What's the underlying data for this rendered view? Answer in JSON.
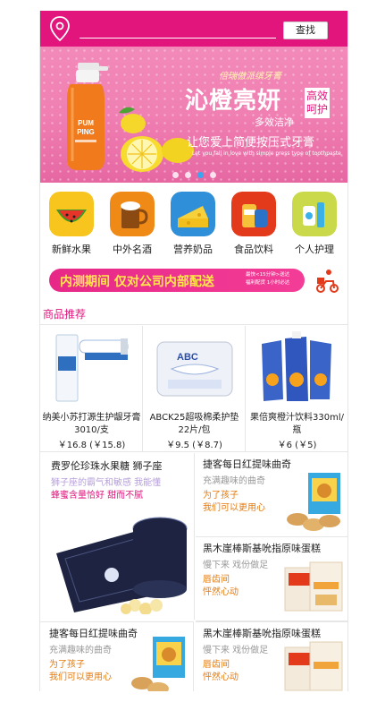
{
  "header": {
    "search_button": "查找",
    "location_icon": "location-pin-icon"
  },
  "banner": {
    "tagline": "倍瑞傲派缤牙膏",
    "title": "沁橙亮妍",
    "side_text": "高效呵护",
    "subtitle": "多效洁净",
    "line3": "让您爱上简便按压式牙膏",
    "line4": "Let you fall in love with simple press type of toothpaste",
    "bottle_text": "PUMPING",
    "slides": 4,
    "active_slide": 2
  },
  "categories": [
    {
      "label": "新鲜水果",
      "icon": "watermelon-icon",
      "color": "#f7c51e"
    },
    {
      "label": "中外名酒",
      "icon": "beer-icon",
      "color": "#f08a16"
    },
    {
      "label": "营养奶品",
      "icon": "cheese-icon",
      "color": "#2f8fd8"
    },
    {
      "label": "食品饮料",
      "icon": "snack-icon",
      "color": "#e23a1a"
    },
    {
      "label": "个人护理",
      "icon": "toothbrush-icon",
      "color": "#c9d94a"
    }
  ],
  "promo": {
    "text": "内测期间  仅对公司内部配送",
    "side1": "最快<15分钟>送达",
    "side2": "福利配货 1小时必达"
  },
  "section": {
    "title": "商品推荐"
  },
  "products": [
    {
      "name": "纳美小苏打源生护龈牙膏3010/支",
      "price": "￥16.8 (￥15.8)"
    },
    {
      "name": "ABCK25超吸棉柔护垫22片/包",
      "price": "￥9.5 (￥8.7)"
    },
    {
      "name": "果倍爽橙汁饮料330ml/瓶",
      "price": "￥6 (￥5)"
    }
  ],
  "featured": {
    "big": {
      "title": "费罗伦珍珠水果糖 狮子座",
      "desc1": "狮子座的霸气和敏感  我能懂",
      "desc2": "蜂蜜含量恰好  甜而不腻"
    },
    "small": [
      {
        "title": "捷客每日红提味曲奇",
        "desc1": "充满趣味的曲奇",
        "desc2": "为了孩子",
        "desc3": "我们可以更用心"
      },
      {
        "title": "黑木崖棒斯基吮指原味蛋糕",
        "desc1": "慢下来  戏份做足",
        "desc2": "唇齿间",
        "desc3": "怦然心动"
      }
    ],
    "bottom": [
      {
        "title": "捷客每日红提味曲奇",
        "desc1": "充满趣味的曲奇",
        "desc2": "为了孩子",
        "desc3": "我们可以更用心"
      },
      {
        "title": "黑木崖棒斯基吮指原味蛋糕",
        "desc1": "慢下来  戏份做足",
        "desc2": "唇齿间",
        "desc3": "怦然心动"
      }
    ]
  }
}
